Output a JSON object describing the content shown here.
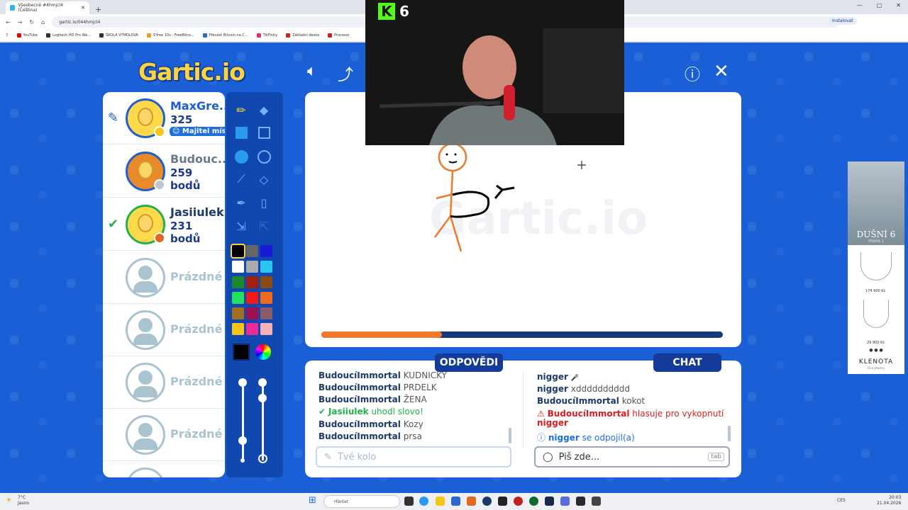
{
  "browser": {
    "tab_title": "Všeobecné #4hmjcl4 (Čeština)",
    "url": "gartic.io/044hmjcl4",
    "install_label": "Instalovat",
    "bookmarks": [
      "YouTube",
      "Logitech HD Pro We...",
      "ŠKOLA VÝMOLOVA",
      "S'free 10s - FreeBitco...",
      "Převést Bitcoin na C...",
      "TikFinity",
      "Základní deska",
      "Procesor"
    ]
  },
  "game": {
    "logo": "Gartic.io",
    "players": [
      {
        "name": "MaxGre...",
        "score": "325 bodů",
        "badge": "Majitel mís",
        "status_color": "#f5c518",
        "drawing": true
      },
      {
        "name": "Budouc...",
        "score": "259 bodů",
        "status_color": "#bfc7cf"
      },
      {
        "name": "Jasiiulek",
        "score": "231 bodů",
        "status_color": "#e0681e",
        "guessed": true
      }
    ],
    "empty_label": "Prázdné",
    "palette": [
      "#000000",
      "#666666",
      "#1a1ad6",
      "#ffffff",
      "#aaaaaa",
      "#2bc4ee",
      "#1a8a2a",
      "#a02010",
      "#8a4a10",
      "#22e060",
      "#ee1a1a",
      "#ee6a20",
      "#a07020",
      "#a01050",
      "#8a5a6a",
      "#f5c518",
      "#ee2a9a",
      "#f5b0b8"
    ],
    "progress": 0.3,
    "answers_label": "ODPOVĚDI",
    "chat_label": "CHAT",
    "answers": [
      {
        "user": "BudoucíImmortal",
        "text": "KUDNICKY"
      },
      {
        "user": "BudoucíImmortal",
        "text": "PRDELK"
      },
      {
        "user": "BudoucíImmortal",
        "text": "ŽENA"
      },
      {
        "user": "Jasiiulek",
        "text": "uhodl slovo!",
        "correct": true
      },
      {
        "user": "BudoucíImmortal",
        "text": "Kozy"
      },
      {
        "user": "BudoucíImmortal",
        "text": "prsa"
      }
    ],
    "answer_placeholder": "Tvé kolo",
    "chat": [
      {
        "user": "nigger",
        "text": "🎤"
      },
      {
        "user": "nigger",
        "text": "xdddddddddd"
      },
      {
        "user": "BudoucíImmortal",
        "text": "kokot"
      }
    ],
    "alert": {
      "user": "BudoucíImmortal",
      "text": "hlasuje pro vykopnutí",
      "target": "nigger"
    },
    "info": {
      "user": "nigger",
      "text": "se odpojil(a)"
    },
    "chat_placeholder": "Piš zde...",
    "tab_hint": "tab"
  },
  "stream": {
    "kick_label": "K",
    "viewer_count": "6"
  },
  "ad": {
    "brand_top": "DUŠNÍ 6",
    "brand_sub": "PRAHA 1",
    "price1": "174 900 Kč",
    "price2": "29 900 Kč",
    "brand_bottom": "KLENOTA",
    "tagline": "Fine Jewelry"
  },
  "taskbar": {
    "temp": "7°C",
    "weather": "Jasno",
    "search": "Hledat",
    "lang": "CES",
    "time": "20:03",
    "date": "21.04.2026"
  }
}
